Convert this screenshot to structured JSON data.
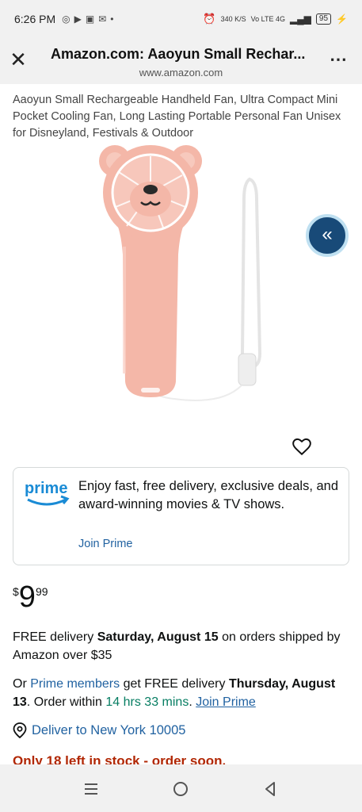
{
  "status": {
    "time": "6:26 PM",
    "speed": "340 K/S",
    "network": "Vo LTE 4G",
    "battery": "95"
  },
  "browser": {
    "title": "Amazon.com: Aaoyun Small Rechar...",
    "url": "www.amazon.com"
  },
  "product": {
    "title": "Aaoyun Small Rechargeable Handheld Fan, Ultra Compact Mini Pocket Cooling Fan, Long Lasting Portable Personal Fan Unisex for Disneyland, Festivals & Outdoor",
    "image_alt": "pink bear handheld fan"
  },
  "prime": {
    "logo_text": "prime",
    "text": "Enjoy fast, free delivery, exclusive deals, and award-winning movies & TV shows.",
    "join": "Join Prime"
  },
  "price": {
    "symbol": "$",
    "whole": "9",
    "fraction": "99"
  },
  "delivery": {
    "free_prefix": "FREE delivery ",
    "free_date": "Saturday, August 15",
    "free_suffix": " on orders shipped by Amazon over $35",
    "or": "Or ",
    "prime_members": "Prime members",
    "get_free": " get FREE delivery ",
    "prime_date": "Thursday, August 13",
    "order_within": ". Order within ",
    "countdown": "14 hrs 33 mins",
    "period": ". ",
    "join_prime": "Join Prime"
  },
  "location": {
    "deliver_to": "Deliver to New York 10005"
  },
  "stock": {
    "text": "Only 18 left in stock - order soon."
  },
  "colors": {
    "link": "#2162a1",
    "green": "#067d62",
    "stock_red": "#b12704",
    "collapse_button": "#184a78",
    "fan_pink": "#f4b7a8"
  }
}
